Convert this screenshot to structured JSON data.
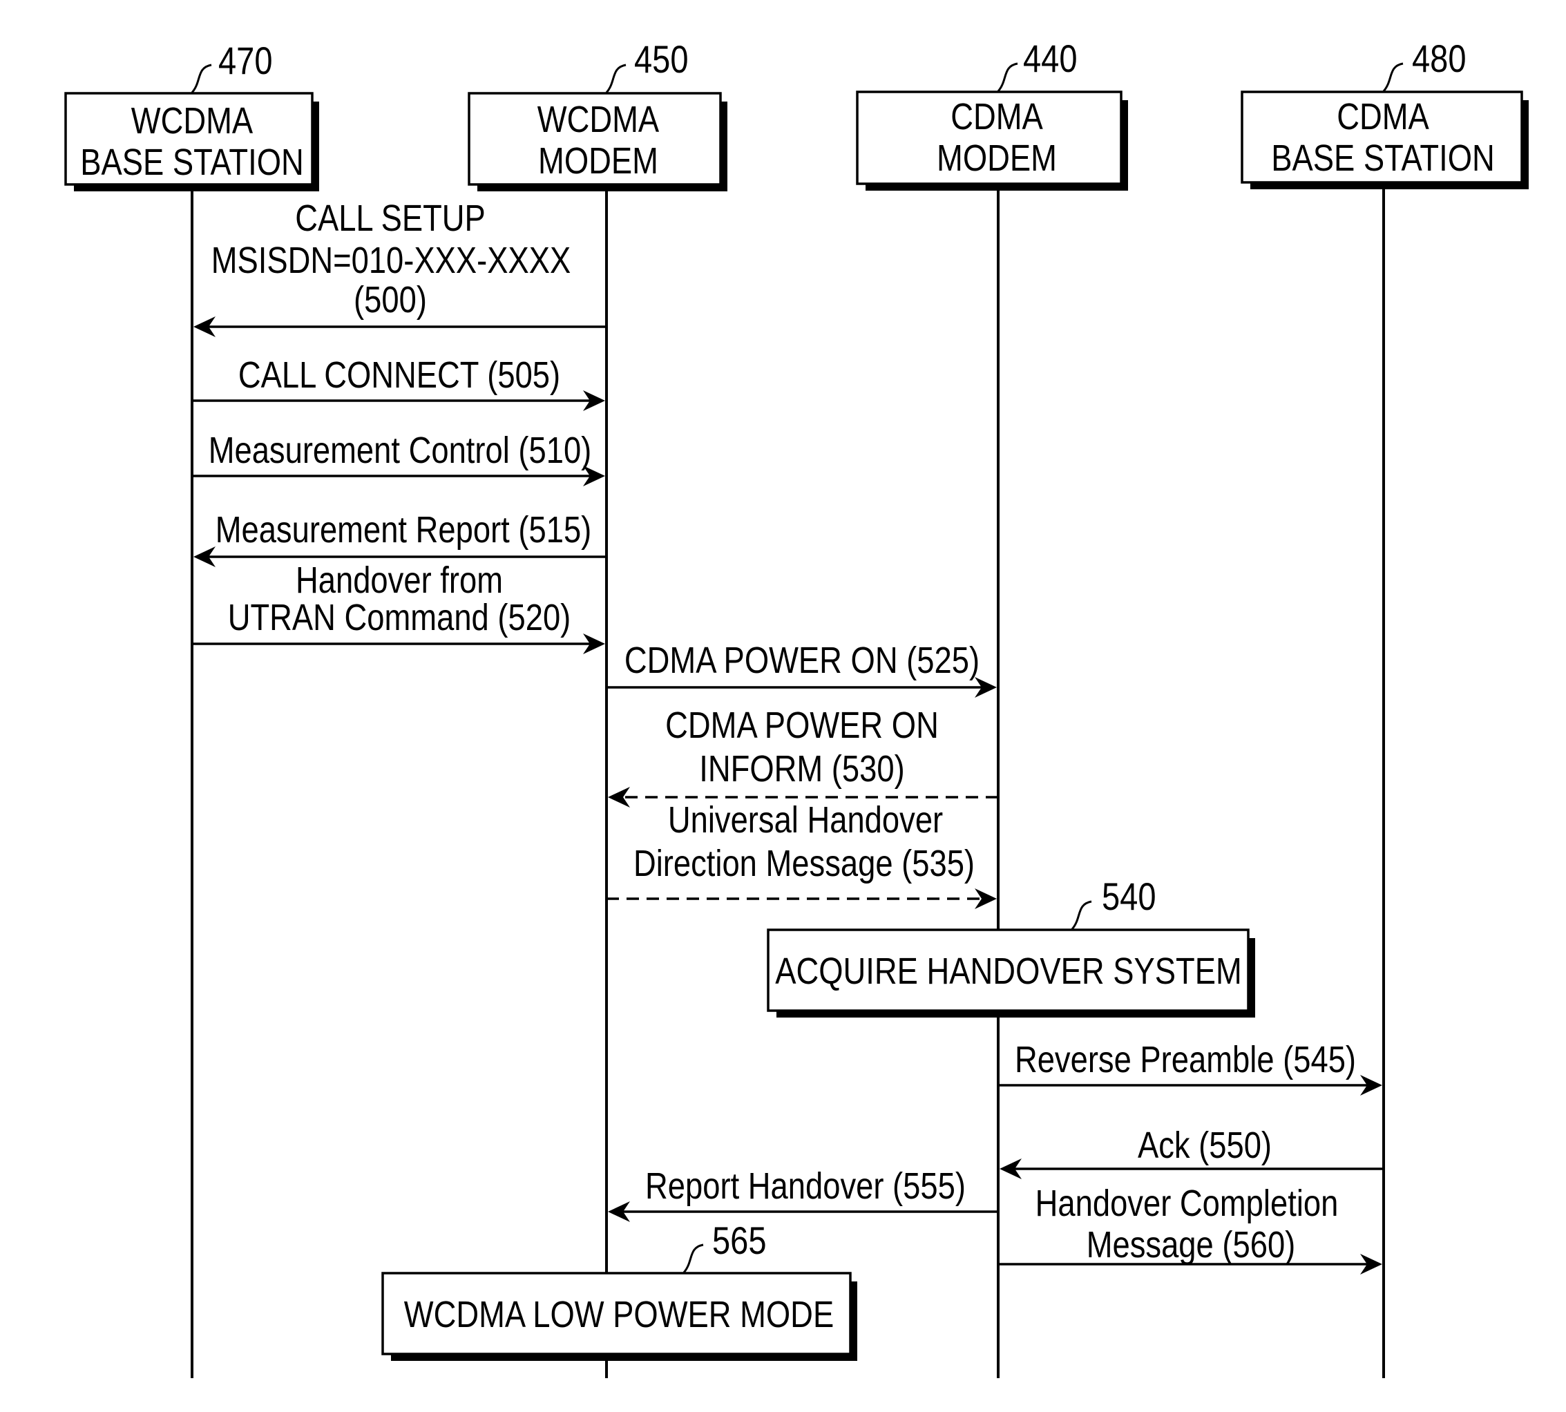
{
  "diagram": {
    "type": "sequence-diagram",
    "participants": [
      {
        "id": "470",
        "ref": "470",
        "lines": [
          "WCDMA",
          "BASE STATION"
        ]
      },
      {
        "id": "450",
        "ref": "450",
        "lines": [
          "WCDMA",
          "MODEM"
        ]
      },
      {
        "id": "440",
        "ref": "440",
        "lines": [
          "CDMA",
          "MODEM"
        ]
      },
      {
        "id": "480",
        "ref": "480",
        "lines": [
          "CDMA",
          "BASE STATION"
        ]
      }
    ],
    "messages": [
      {
        "step": "500",
        "from": "450",
        "to": "470",
        "style": "solid",
        "lines": [
          "CALL SETUP",
          "MSISDN=010-XXX-XXXX",
          "(500)"
        ]
      },
      {
        "step": "505",
        "from": "470",
        "to": "450",
        "style": "solid",
        "lines": [
          "CALL CONNECT (505)"
        ]
      },
      {
        "step": "510",
        "from": "470",
        "to": "450",
        "style": "solid",
        "lines": [
          "Measurement Control (510)"
        ]
      },
      {
        "step": "515",
        "from": "450",
        "to": "470",
        "style": "solid",
        "lines": [
          "Measurement Report (515)"
        ]
      },
      {
        "step": "520",
        "from": "470",
        "to": "450",
        "style": "solid",
        "lines": [
          "Handover from",
          "UTRAN Command (520)"
        ]
      },
      {
        "step": "525",
        "from": "450",
        "to": "440",
        "style": "solid",
        "lines": [
          "CDMA POWER ON (525)"
        ]
      },
      {
        "step": "530",
        "from": "440",
        "to": "450",
        "style": "dashed",
        "lines": [
          "CDMA POWER ON",
          "INFORM (530)"
        ]
      },
      {
        "step": "535",
        "from": "450",
        "to": "440",
        "style": "dashed",
        "lines": [
          "Universal Handover",
          "Direction Message (535)"
        ]
      },
      {
        "step": "545",
        "from": "440",
        "to": "480",
        "style": "solid",
        "lines": [
          "Reverse Preamble (545)"
        ]
      },
      {
        "step": "550",
        "from": "480",
        "to": "440",
        "style": "solid",
        "lines": [
          "Ack (550)"
        ]
      },
      {
        "step": "555",
        "from": "440",
        "to": "450",
        "style": "solid",
        "lines": [
          "Report Handover (555)"
        ]
      },
      {
        "step": "560",
        "from": "440",
        "to": "480",
        "style": "solid",
        "lines": [
          "Handover Completion",
          "Message (560)"
        ]
      }
    ],
    "process_boxes": [
      {
        "ref": "540",
        "on": "440",
        "label": "ACQUIRE HANDOVER SYSTEM"
      },
      {
        "ref": "565",
        "on": "450",
        "label": "WCDMA LOW POWER MODE"
      }
    ]
  }
}
